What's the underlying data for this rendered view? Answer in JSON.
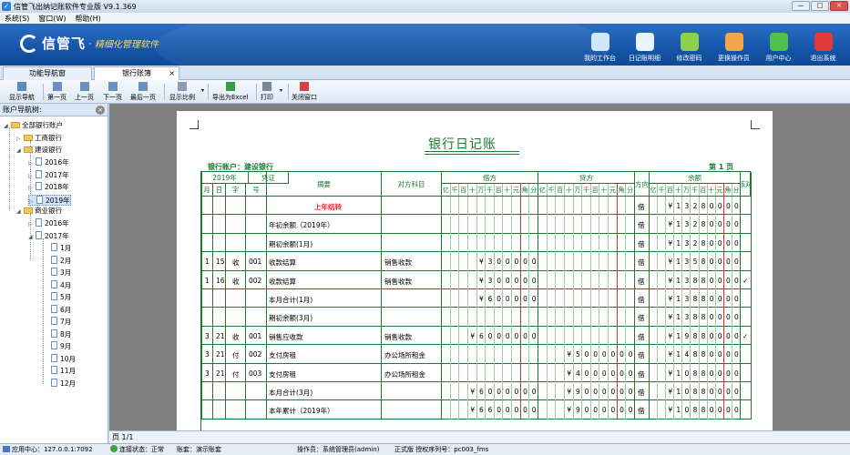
{
  "window": {
    "title": "信管飞出纳记账软件专业版 V9.1.369",
    "controls": [
      "—",
      "□",
      "✕"
    ]
  },
  "menu": [
    "系统(S)",
    "窗口(W)",
    "帮助(H)"
  ],
  "brand": {
    "name": "信管飞",
    "slogan": "精细化管理软件"
  },
  "top_buttons": [
    {
      "label": "我的工作台",
      "icon": "monitor-icon",
      "color": "#cfe6ff"
    },
    {
      "label": "日记账明细",
      "icon": "ledger-list-icon",
      "color": "#e9f2ff"
    },
    {
      "label": "修改密码",
      "icon": "key-lock-icon",
      "color": "#8fd14f"
    },
    {
      "label": "更换操作员",
      "icon": "user-icon",
      "color": "#f3a64a"
    },
    {
      "label": "用户中心",
      "icon": "globe-icon",
      "color": "#4fc04a"
    },
    {
      "label": "退出系统",
      "icon": "power-icon",
      "color": "#e23b3b"
    }
  ],
  "tabs": [
    {
      "label": "功能导航窗"
    },
    {
      "label": "银行账簿",
      "close": "×"
    }
  ],
  "toolbar": [
    "显示导航",
    "第一页",
    "上一页",
    "下一页",
    "最后一页",
    "显示比例",
    "导出为Excel",
    "打印",
    "关闭窗口"
  ],
  "left_panel": {
    "title": "账户导航树:",
    "close": "×"
  },
  "tree": {
    "root": "全部银行账户",
    "banks": [
      {
        "name": "工商银行"
      },
      {
        "name": "建设银行",
        "years": [
          "2016年",
          "2017年",
          "2018年",
          "2019年"
        ],
        "selected": "2019年"
      },
      {
        "name": "商业银行",
        "years": [
          "2016年",
          "2017年"
        ],
        "months": [
          "1月",
          "2月",
          "3月",
          "4月",
          "5月",
          "6月",
          "7月",
          "8月",
          "9月",
          "10月",
          "11月",
          "12月"
        ]
      }
    ]
  },
  "report": {
    "title": "银行日记账",
    "account": "银行账户：建设银行",
    "page": "第  1  页",
    "headers": {
      "year": "2019年",
      "voucher": "凭证",
      "month": "月",
      "day": "日",
      "word": "字",
      "number": "号",
      "summary": "摘要",
      "opposite": "对方科目",
      "debit": "借方",
      "credit": "贷方",
      "direction": "方向",
      "balance": "余额",
      "check": "核对",
      "digits": [
        "亿",
        "千",
        "百",
        "十",
        "万",
        "千",
        "百",
        "十",
        "元",
        "角",
        "分"
      ]
    },
    "rows": [
      {
        "m": "",
        "d": "",
        "w": "",
        "n": "",
        "summary": "上年结转",
        "opp": "",
        "debit": "",
        "credit": "",
        "dir": "借",
        "bal": "¥13280000",
        "chk": "",
        "carry": true
      },
      {
        "m": "",
        "d": "",
        "w": "",
        "n": "",
        "summary": "年初余额（2019年）",
        "opp": "",
        "debit": "",
        "credit": "",
        "dir": "借",
        "bal": "¥13280000",
        "chk": ""
      },
      {
        "m": "",
        "d": "",
        "w": "",
        "n": "",
        "summary": "期初余额(1月)",
        "opp": "",
        "debit": "",
        "credit": "",
        "dir": "借",
        "bal": "¥13280000",
        "chk": ""
      },
      {
        "m": "1",
        "d": "15",
        "w": "收",
        "n": "001",
        "summary": "收款结算",
        "opp": "销售收款",
        "debit": "¥300000",
        "credit": "",
        "dir": "借",
        "bal": "¥13580000",
        "chk": ""
      },
      {
        "m": "1",
        "d": "16",
        "w": "收",
        "n": "002",
        "summary": "收款结算",
        "opp": "销售收款",
        "debit": "¥300000",
        "credit": "",
        "dir": "借",
        "bal": "¥13880000",
        "chk": "✓"
      },
      {
        "m": "",
        "d": "",
        "w": "",
        "n": "",
        "summary": "本月合计(1月)",
        "opp": "",
        "debit": "¥600000",
        "credit": "",
        "dir": "借",
        "bal": "¥13880000",
        "chk": ""
      },
      {
        "m": "",
        "d": "",
        "w": "",
        "n": "",
        "summary": "期初余额(3月)",
        "opp": "",
        "debit": "",
        "credit": "",
        "dir": "借",
        "bal": "¥13880000",
        "chk": ""
      },
      {
        "m": "3",
        "d": "21",
        "w": "收",
        "n": "001",
        "summary": "销售应收款",
        "opp": "销售收款",
        "debit": "¥6000000",
        "credit": "",
        "dir": "借",
        "bal": "¥19880000",
        "chk": "✓"
      },
      {
        "m": "3",
        "d": "21",
        "w": "付",
        "n": "002",
        "summary": "支付房租",
        "opp": "办公场所租金",
        "debit": "",
        "credit": "¥5000000",
        "dir": "借",
        "bal": "¥14880000",
        "chk": ""
      },
      {
        "m": "3",
        "d": "21",
        "w": "付",
        "n": "003",
        "summary": "支付房租",
        "opp": "办公场所租金",
        "debit": "",
        "credit": "¥4000000",
        "dir": "借",
        "bal": "¥10880000",
        "chk": ""
      },
      {
        "m": "",
        "d": "",
        "w": "",
        "n": "",
        "summary": "本月合计(3月)",
        "opp": "",
        "debit": "¥6000000",
        "credit": "¥9000000",
        "dir": "借",
        "bal": "¥10880000",
        "chk": ""
      },
      {
        "m": "",
        "d": "",
        "w": "",
        "n": "",
        "summary": "本年累计（2019年）",
        "opp": "",
        "debit": "¥6600000",
        "credit": "¥9000000",
        "dir": "借",
        "bal": "¥10880000",
        "chk": ""
      }
    ]
  },
  "pager": "页 1/1",
  "status": [
    "应用中心：127.0.0.1:7092",
    "连接状态：正常",
    "账套：演示账套",
    "操作员：系统管理员(admin)",
    "正式版 授权序列号：pc003_fms"
  ],
  "colors": {
    "ink": "#1a7a32",
    "red": "#e03030",
    "banner": "#1555a8"
  }
}
